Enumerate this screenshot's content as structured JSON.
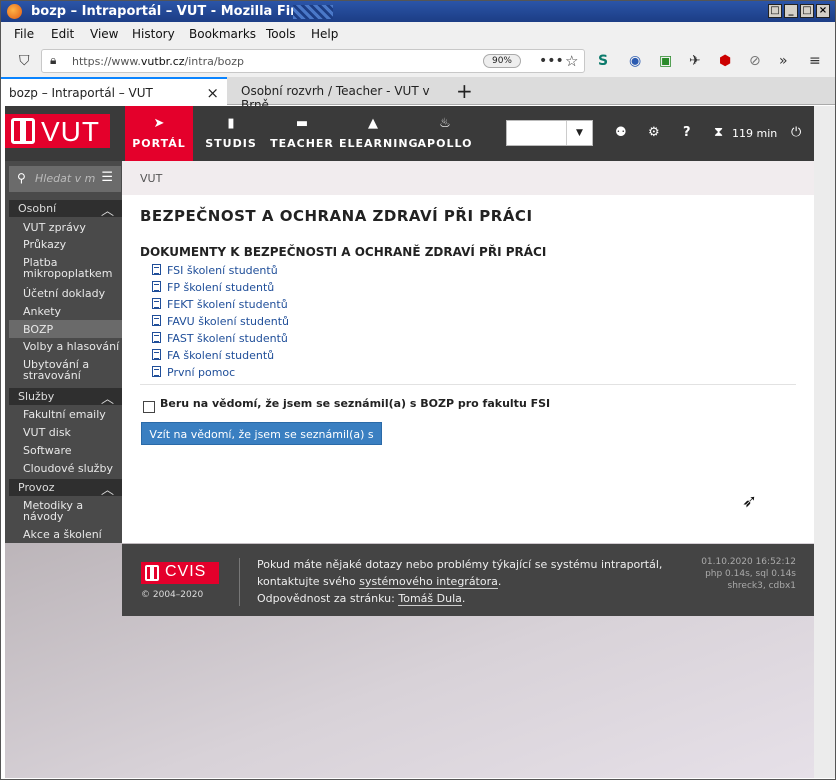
{
  "window": {
    "title": "bozp – Intraportál – VUT - Mozilla Firefox"
  },
  "menu": [
    "File",
    "Edit",
    "View",
    "History",
    "Bookmarks",
    "Tools",
    "Help"
  ],
  "navbar": {
    "url_prefix": "https://www.",
    "url_domain": "vutbr.cz",
    "url_path": "/intra/bozp",
    "zoom": "90%"
  },
  "tabs": [
    {
      "label": "bozp – Intraportál – VUT"
    },
    {
      "label": "Osobní rozvrh / Teacher - VUT v Brně"
    }
  ],
  "portal": {
    "logo": "VUT",
    "modules": [
      {
        "label": "PORTÁL",
        "icon": "navigation-icon"
      },
      {
        "label": "STUDIS",
        "icon": "book-icon"
      },
      {
        "label": "TEACHER",
        "icon": "briefcase-icon"
      },
      {
        "label": "ELEARNING",
        "icon": "graduation-cap-icon"
      },
      {
        "label": "APOLLO",
        "icon": "flame-icon"
      }
    ],
    "session": "119 min"
  },
  "sidebar": {
    "search_placeholder": "Hledat v menu",
    "groups": [
      {
        "label": "Osobní",
        "items": [
          "VUT zprávy",
          "Průkazy",
          "Platba mikropoplatkem",
          "Účetní doklady",
          "Ankety",
          "BOZP",
          "Volby a hlasování",
          "Ubytování a stravování"
        ]
      },
      {
        "label": "Služby",
        "items": [
          "Fakultní emaily",
          "VUT disk",
          "Software",
          "Cloudové služby"
        ]
      },
      {
        "label": "Provoz",
        "items": [
          "Metodiky a návody",
          "Akce a školení"
        ]
      }
    ]
  },
  "content": {
    "breadcrumb": "VUT",
    "title": "BEZPEČNOST A OCHRANA ZDRAVÍ PŘI PRÁCI",
    "subtitle": "DOKUMENTY K BEZPEČNOSTI A OCHRANĚ ZDRAVÍ PŘI PRÁCI",
    "documents": [
      "FSI školení studentů",
      "FP školení studentů",
      "FEKT školení studentů",
      "FAVU školení studentů",
      "FAST školení studentů",
      "FA školení studentů",
      "První pomoc"
    ],
    "checkbox_label": "Beru na vědomí, že jsem se seznámil(a) s BOZP pro fakultu FSI",
    "button_label": "Vzít na vědomí, že jsem se seznámil(a) s BOZP"
  },
  "footer": {
    "logo": "CVIS",
    "copyright": "© 2004–2020",
    "line1": "Pokud máte nějaké dotazy nebo problémy týkající se systému intraportál,",
    "line2_prefix": "kontaktujte svého ",
    "line2_link": "systémového integrátora",
    "line2_suffix": ".",
    "line3_prefix": "Odpovědnost za stránku: ",
    "line3_link": "Tomáš Dula",
    "line3_suffix": ".",
    "timestamp": "01.10.2020 16:52:12",
    "perf": "php 0.14s, sql 0.14s",
    "server": "shreck3, cdbx1"
  }
}
